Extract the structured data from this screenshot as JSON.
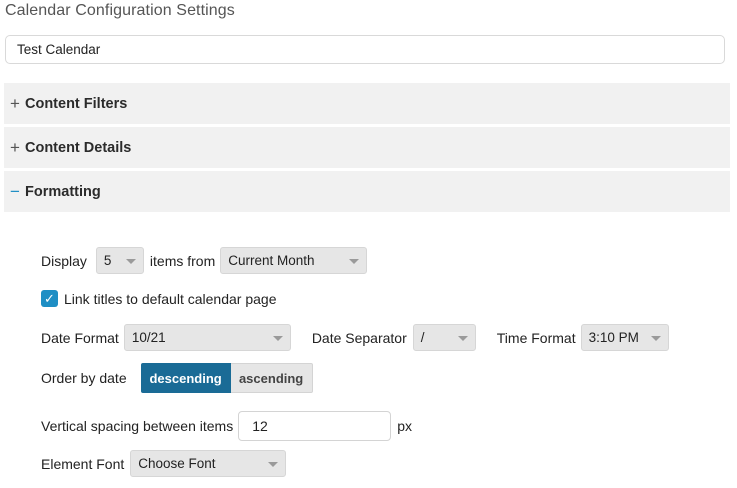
{
  "page_title": "Calendar Configuration Settings",
  "calendar_name": {
    "value": "Test Calendar"
  },
  "sections": [
    {
      "label": "Content Filters",
      "toggle": "+"
    },
    {
      "label": "Content Details",
      "toggle": "+"
    },
    {
      "label": "Formatting",
      "toggle": "−"
    }
  ],
  "formatting": {
    "display_label": "Display",
    "display_count": "5",
    "items_from_label": "items from",
    "items_from_value": "Current Month",
    "link_titles_label": "Link titles to default calendar page",
    "link_titles_checked": true,
    "check_glyph": "✓",
    "date_format_label": "Date Format",
    "date_format_value": "10/21",
    "date_separator_label": "Date Separator",
    "date_separator_value": "/",
    "time_format_label": "Time Format",
    "time_format_value": "3:10 PM",
    "order_label": "Order by date",
    "order_options": [
      "descending",
      "ascending"
    ],
    "order_selected": "descending",
    "spacing_label": "Vertical spacing between items",
    "spacing_value": "12",
    "spacing_unit": "px",
    "font_label": "Element Font",
    "font_value": "Choose Font"
  },
  "colors": {
    "accent": "#1e8ec4",
    "active_button": "#1a6b96",
    "section_bg": "#f1f1f1",
    "select_bg": "#e6e6e6"
  }
}
